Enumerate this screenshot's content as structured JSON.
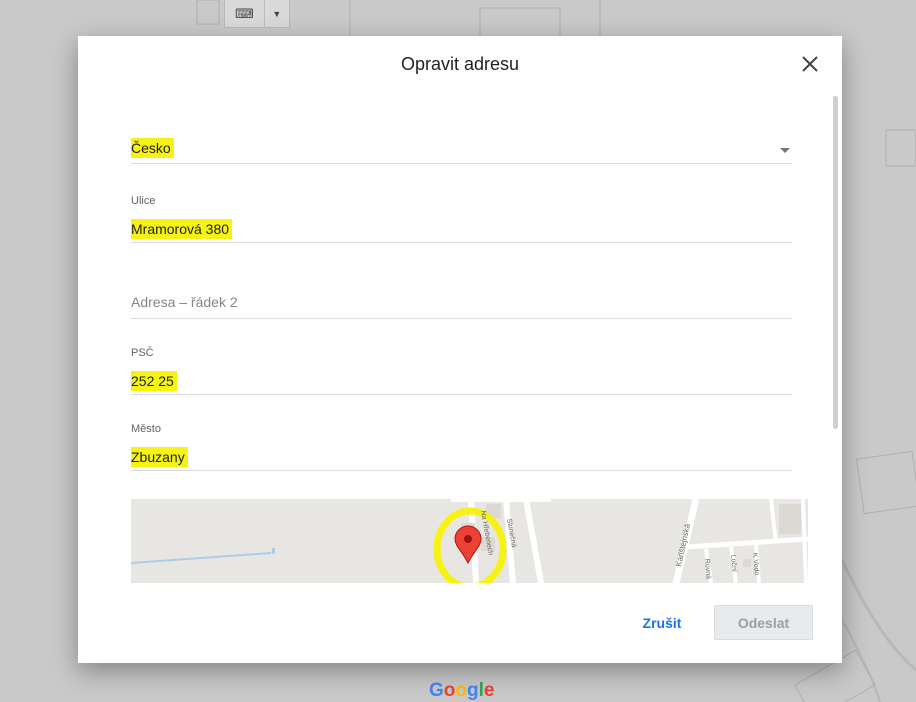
{
  "background": {
    "keyboard_icon": "keyboard-icon",
    "dropdown_icon": "caret-down-icon",
    "google_logo": "Google"
  },
  "dialog": {
    "title": "Opravit adresu",
    "close_icon": "close-icon",
    "fields": {
      "country": {
        "value": "Česko"
      },
      "street": {
        "label": "Ulice",
        "value": "Mramorová 380"
      },
      "address2": {
        "placeholder": "Adresa – řádek 2"
      },
      "zip": {
        "label": "PSČ",
        "value": "252 25"
      },
      "city": {
        "label": "Město",
        "value": "Zbuzany"
      }
    },
    "map": {
      "streets": [
        "Na Hřebenech",
        "Slunečná",
        "Karlštejnská",
        "Rovná",
        "Luční",
        "K Vodo"
      ],
      "marker_icon": "map-pin-icon"
    },
    "buttons": {
      "cancel": "Zrušit",
      "submit": "Odeslat"
    }
  },
  "colors": {
    "highlight": "#f6f213",
    "accent": "#1a73e8",
    "marker": "#ea4335"
  }
}
